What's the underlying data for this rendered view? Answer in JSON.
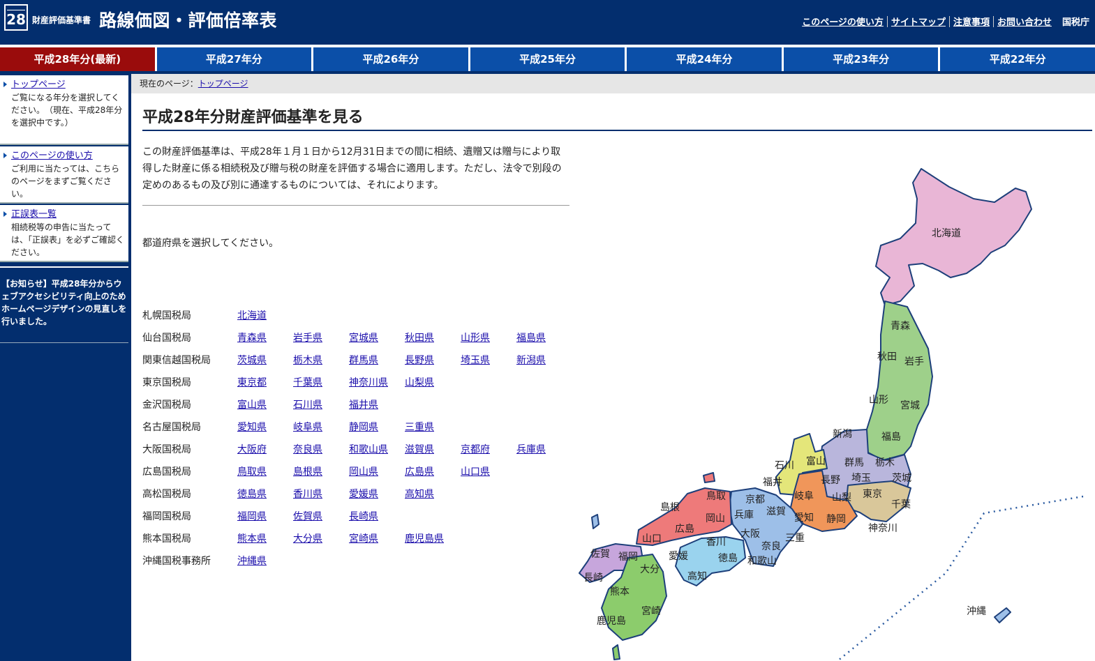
{
  "header": {
    "logo_number": "28",
    "subtitle": "財産評価基準書",
    "title": "路線価図・評価倍率表",
    "util_links": [
      "このページの使い方",
      "サイトマップ",
      "注意事項",
      "お問い合わせ"
    ],
    "agency": "国税庁"
  },
  "year_tabs": [
    "平成28年分(最新)",
    "平成27年分",
    "平成26年分",
    "平成25年分",
    "平成24年分",
    "平成23年分",
    "平成22年分"
  ],
  "sidebar": {
    "items": [
      {
        "link": "トップページ",
        "desc": "ご覧になる年分を選択してください。　（現在、平成28年分を選択中です。）"
      },
      {
        "link": "このページの使い方",
        "desc": "ご利用に当たっては、こちらのページをまずご覧ください。"
      },
      {
        "link": "正誤表一覧",
        "desc": "相続税等の申告に当たっては、「正誤表」を必ずご確認ください。"
      }
    ],
    "notice": "【お知らせ】平成28年分からウェブアクセシビリティ向上のためホームページデザインの見直しを行いました。"
  },
  "breadcrumb": {
    "prefix": "現在のページ：",
    "link": "トップページ"
  },
  "main": {
    "title": "平成28年分財産評価基準を見る",
    "intro": "この財産評価基準は、平成28年１月１日から12月31日までの間に相続、遺贈又は贈与により取得した財産に係る相続税及び贈与税の財産を評価する場合に適用します。ただし、法令で別段の定めのあるもの及び別に通達するものについては、それによります。",
    "prompt": "都道府県を選択してください。",
    "bureaus": [
      {
        "name": "札幌国税局",
        "prefs": [
          "北海道"
        ]
      },
      {
        "name": "仙台国税局",
        "prefs": [
          "青森県",
          "岩手県",
          "宮城県",
          "秋田県",
          "山形県",
          "福島県"
        ]
      },
      {
        "name": "関東信越国税局",
        "prefs": [
          "茨城県",
          "栃木県",
          "群馬県",
          "長野県",
          "埼玉県",
          "新潟県"
        ]
      },
      {
        "name": "東京国税局",
        "prefs": [
          "東京都",
          "千葉県",
          "神奈川県",
          "山梨県"
        ]
      },
      {
        "name": "金沢国税局",
        "prefs": [
          "富山県",
          "石川県",
          "福井県"
        ]
      },
      {
        "name": "名古屋国税局",
        "prefs": [
          "愛知県",
          "岐阜県",
          "静岡県",
          "三重県"
        ]
      },
      {
        "name": "大阪国税局",
        "prefs": [
          "大阪府",
          "奈良県",
          "和歌山県",
          "滋賀県",
          "京都府",
          "兵庫県"
        ]
      },
      {
        "name": "広島国税局",
        "prefs": [
          "鳥取県",
          "島根県",
          "岡山県",
          "広島県",
          "山口県"
        ]
      },
      {
        "name": "高松国税局",
        "prefs": [
          "徳島県",
          "香川県",
          "愛媛県",
          "高知県"
        ]
      },
      {
        "name": "福岡国税局",
        "prefs": [
          "福岡県",
          "佐賀県",
          "長崎県"
        ]
      },
      {
        "name": "熊本国税局",
        "prefs": [
          "熊本県",
          "大分県",
          "宮崎県",
          "鹿児島県"
        ]
      },
      {
        "name": "沖縄国税事務所",
        "prefs": [
          "沖縄県"
        ]
      }
    ]
  },
  "map": {
    "region_colors": {
      "hokkaido": "#e9b6d6",
      "tohoku": "#9ed08a",
      "kanto": "#b9b6dc",
      "tokyo": "#d9c79a",
      "hokuriku": "#e4e67a",
      "chubu": "#f0965a",
      "kinki": "#9dbfe8",
      "chugoku": "#ee7a7a",
      "shikoku": "#9ad3ee",
      "kyushu": "#8ccc6c",
      "kyushu_north": "#c7a6dc",
      "okinawa": "#9dbfe8"
    },
    "labels": [
      "北海道",
      "青森",
      "秋田",
      "岩手",
      "山形",
      "宮城",
      "新潟",
      "福島",
      "石川",
      "富山",
      "群馬",
      "栃木",
      "福井",
      "長野",
      "埼玉",
      "茨城",
      "岐阜",
      "山梨",
      "東京",
      "千葉",
      "神奈川",
      "京都",
      "滋賀",
      "愛知",
      "静岡",
      "兵庫",
      "大阪",
      "三重",
      "奈良",
      "和歌山",
      "鳥取",
      "島根",
      "岡山",
      "広島",
      "山口",
      "香川",
      "徳島",
      "愛媛",
      "高知",
      "佐賀",
      "福岡",
      "長崎",
      "大分",
      "熊本",
      "宮崎",
      "鹿児島",
      "沖縄"
    ]
  }
}
